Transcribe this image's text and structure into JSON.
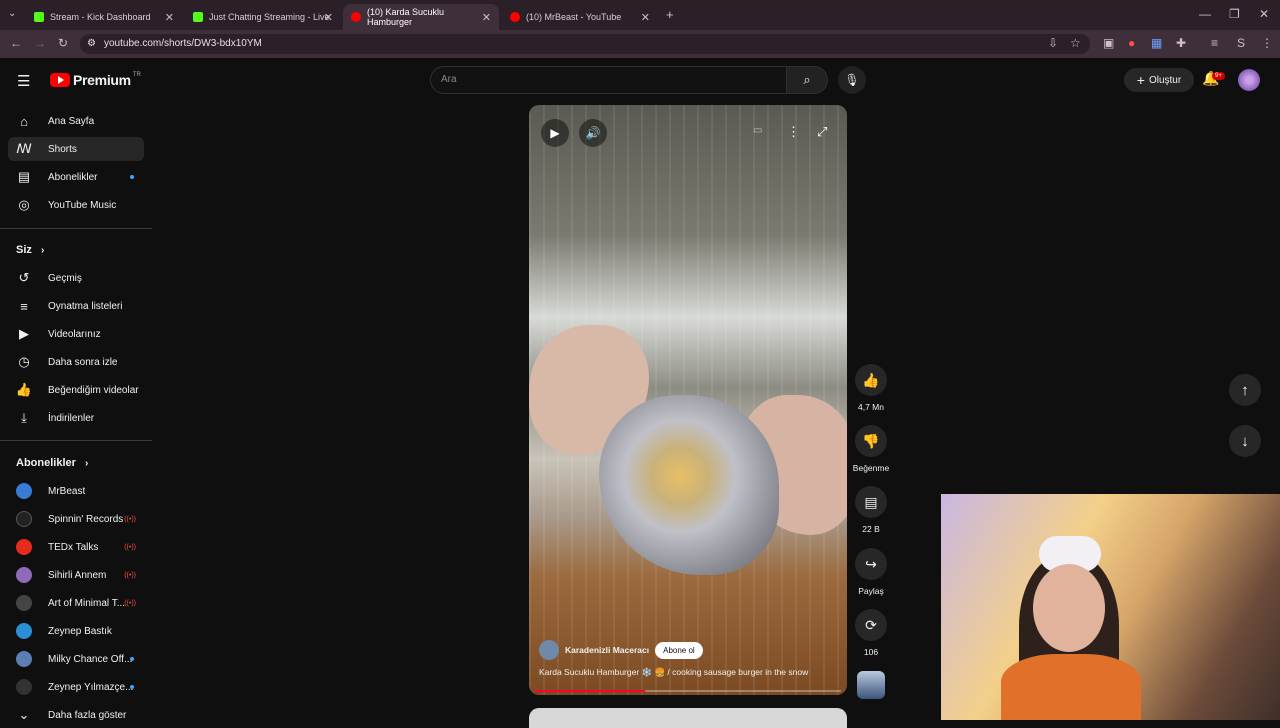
{
  "browser": {
    "tabs": [
      {
        "title": "Stream - Kick Dashboard",
        "favicon_color": "#53fc18"
      },
      {
        "title": "Just Chatting Streaming - Live",
        "favicon_color": "#53fc18"
      },
      {
        "title": "(10) Karda Sucuklu Hamburger",
        "favicon_color": "#ff0000"
      },
      {
        "title": "(10) MrBeast - YouTube",
        "favicon_color": "#ff0000"
      }
    ],
    "url": "youtube.com/shorts/DW3-bdx10YM",
    "profile_initial": "S"
  },
  "header": {
    "logo_text": "Premium",
    "logo_sup": "TR",
    "search_placeholder": "Ara",
    "create_label": "Oluştur",
    "notifications_badge": "9+"
  },
  "sidebar": {
    "main": [
      {
        "label": "Ana Sayfa",
        "icon": "home-icon",
        "glyph": "⌂"
      },
      {
        "label": "Shorts",
        "icon": "shorts-icon",
        "glyph": "ꟿ"
      },
      {
        "label": "Abonelikler",
        "icon": "subscriptions-icon",
        "glyph": "▤"
      },
      {
        "label": "YouTube Music",
        "icon": "music-icon",
        "glyph": "◎"
      }
    ],
    "you_heading": "Siz",
    "you": [
      {
        "label": "Geçmiş",
        "icon": "history-icon",
        "glyph": "↺"
      },
      {
        "label": "Oynatma listeleri",
        "icon": "playlist-icon",
        "glyph": "≡"
      },
      {
        "label": "Videolarınız",
        "icon": "your-videos-icon",
        "glyph": "▶"
      },
      {
        "label": "Daha sonra izle",
        "icon": "watch-later-icon",
        "glyph": "◷"
      },
      {
        "label": "Beğendiğim videolar",
        "icon": "liked-icon",
        "glyph": "👍"
      },
      {
        "label": "İndirilenler",
        "icon": "download-icon",
        "glyph": "⤓"
      }
    ],
    "subs_heading": "Abonelikler",
    "subscriptions": [
      {
        "label": "MrBeast",
        "color": "#3a7bd5",
        "indicator": "none"
      },
      {
        "label": "Spinnin' Records",
        "color": "#222222",
        "indicator": "live"
      },
      {
        "label": "TEDx Talks",
        "color": "#e62b1e",
        "indicator": "live"
      },
      {
        "label": "Sihirli Annem",
        "color": "#8e6bb8",
        "indicator": "live"
      },
      {
        "label": "Art of Minimal T...",
        "color": "#444444",
        "indicator": "live"
      },
      {
        "label": "Zeynep Bastık",
        "color": "#2a8fd6",
        "indicator": "none"
      },
      {
        "label": "Milky Chance Off...",
        "color": "#5b7fb3",
        "indicator": "dot"
      },
      {
        "label": "Zeynep Yılmazçe...",
        "color": "#333333",
        "indicator": "dot"
      }
    ],
    "show_more": "Daha fazla göster"
  },
  "short": {
    "channel": "Karadenizli Maceracı",
    "subscribe_label": "Abone ol",
    "title": "Karda Sucuklu Hamburger ❄️ 🍔 / cooking sausage burger in the snow",
    "progress": 0.36
  },
  "actions": [
    {
      "icon": "like-icon",
      "glyph": "👍",
      "label": "4,7 Mn"
    },
    {
      "icon": "dislike-icon",
      "glyph": "👎",
      "label": "Beğenme"
    },
    {
      "icon": "comments-icon",
      "glyph": "▤",
      "label": "22 B"
    },
    {
      "icon": "share-icon",
      "glyph": "↪",
      "label": "Paylaş"
    },
    {
      "icon": "remix-icon",
      "glyph": "⟳",
      "label": "106"
    }
  ]
}
